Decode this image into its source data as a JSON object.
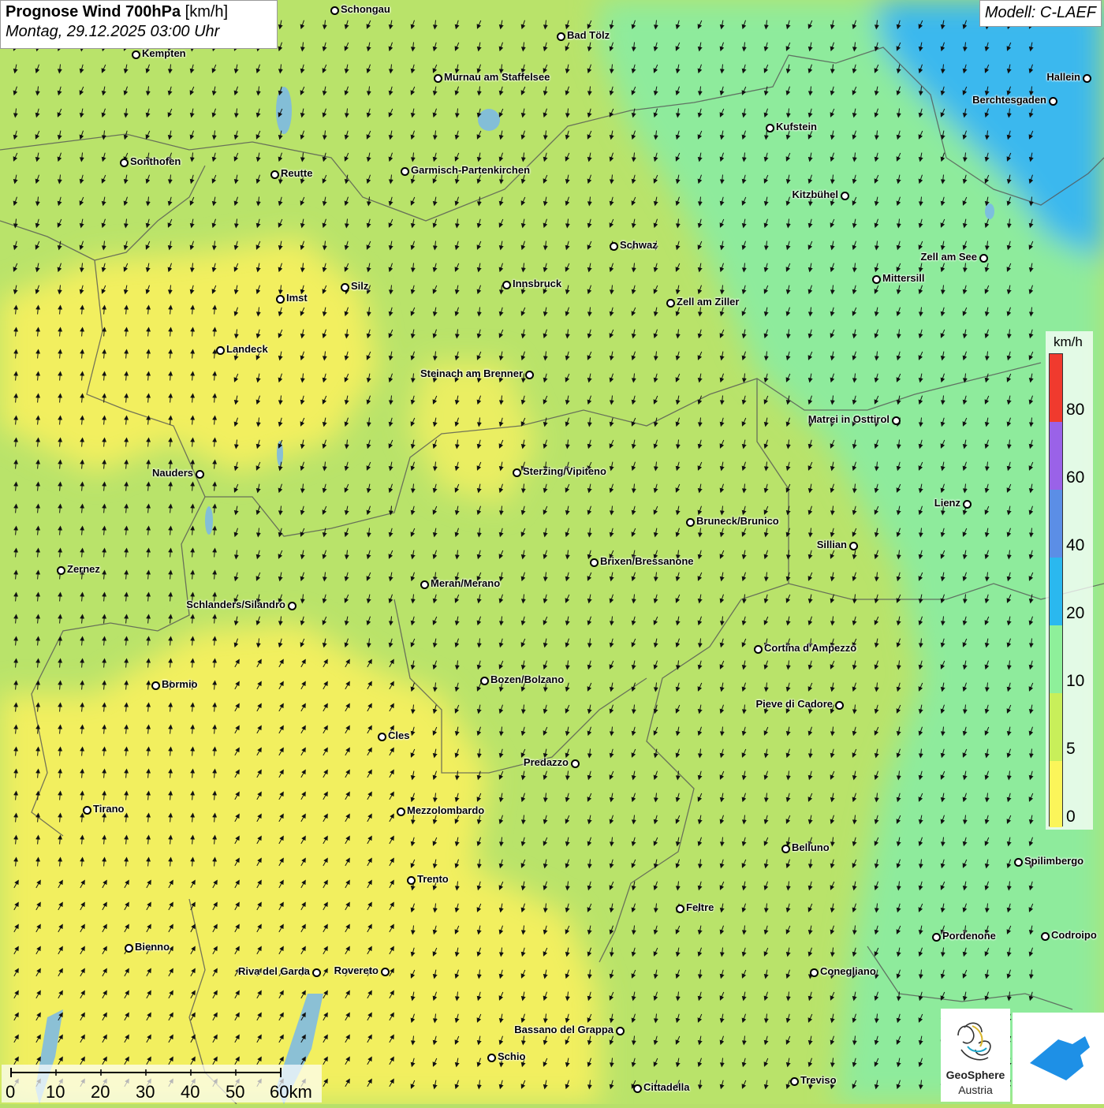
{
  "header": {
    "title_bold": "Prognose Wind 700hPa",
    "title_unit": "[km/h]",
    "datetime": "Montag, 29.12.2025 03:00 Uhr"
  },
  "model": {
    "label": "Modell: C-LAEF"
  },
  "legend": {
    "unit": "km/h",
    "labels": [
      "80",
      "60",
      "40",
      "20",
      "10",
      "5",
      "0"
    ],
    "colors": {
      "above_80": "#f03a2e",
      "60_80": "#9a62e8",
      "40_60": "#5b8ee6",
      "20_40": "#2ab8ef",
      "10_20": "#8ef09a",
      "5_10": "#c8ef5a",
      "0_5": "#fbf55a"
    }
  },
  "scale": {
    "labels": [
      "0",
      "10",
      "20",
      "30",
      "40",
      "50",
      "60km"
    ]
  },
  "cities": [
    {
      "name": "Schongau"
    },
    {
      "name": "Bad Tölz"
    },
    {
      "name": "Kempten"
    },
    {
      "name": "Murnau am Staffelsee"
    },
    {
      "name": "Hallein"
    },
    {
      "name": "Berchtesgaden"
    },
    {
      "name": "Kufstein"
    },
    {
      "name": "Sonthofen"
    },
    {
      "name": "Reutte"
    },
    {
      "name": "Garmisch-Partenkirchen"
    },
    {
      "name": "Kitzbühel"
    },
    {
      "name": "Schwaz"
    },
    {
      "name": "Zell am See"
    },
    {
      "name": "Mittersill"
    },
    {
      "name": "Silz"
    },
    {
      "name": "Innsbruck"
    },
    {
      "name": "Imst"
    },
    {
      "name": "Zell am Ziller"
    },
    {
      "name": "Landeck"
    },
    {
      "name": "Steinach am Brenner"
    },
    {
      "name": "Matrei in Osttirol"
    },
    {
      "name": "Nauders"
    },
    {
      "name": "Sterzing/Vipiteno"
    },
    {
      "name": "Lienz"
    },
    {
      "name": "Bruneck/Brunico"
    },
    {
      "name": "Sillian"
    },
    {
      "name": "Brixen/Bressanone"
    },
    {
      "name": "Zernez"
    },
    {
      "name": "Meran/Merano"
    },
    {
      "name": "Schlanders/Silandro"
    },
    {
      "name": "Cortina d'Ampezzo"
    },
    {
      "name": "Bozen/Bolzano"
    },
    {
      "name": "Bormio"
    },
    {
      "name": "Pieve di Cadore"
    },
    {
      "name": "Cles"
    },
    {
      "name": "Predazzo"
    },
    {
      "name": "Tirano"
    },
    {
      "name": "Mezzolombardo"
    },
    {
      "name": "Belluno"
    },
    {
      "name": "Spilimbergo"
    },
    {
      "name": "Trento"
    },
    {
      "name": "Feltre"
    },
    {
      "name": "Pordenone"
    },
    {
      "name": "Codroipo"
    },
    {
      "name": "Bienno"
    },
    {
      "name": "Riva del Garda"
    },
    {
      "name": "Rovereto"
    },
    {
      "name": "Conegliano"
    },
    {
      "name": "Bassano del Grappa"
    },
    {
      "name": "Schio"
    },
    {
      "name": "Cittadella"
    },
    {
      "name": "Treviso"
    }
  ],
  "logo": {
    "brand_bold": "GeoSphere",
    "brand_sub": "Austria"
  }
}
